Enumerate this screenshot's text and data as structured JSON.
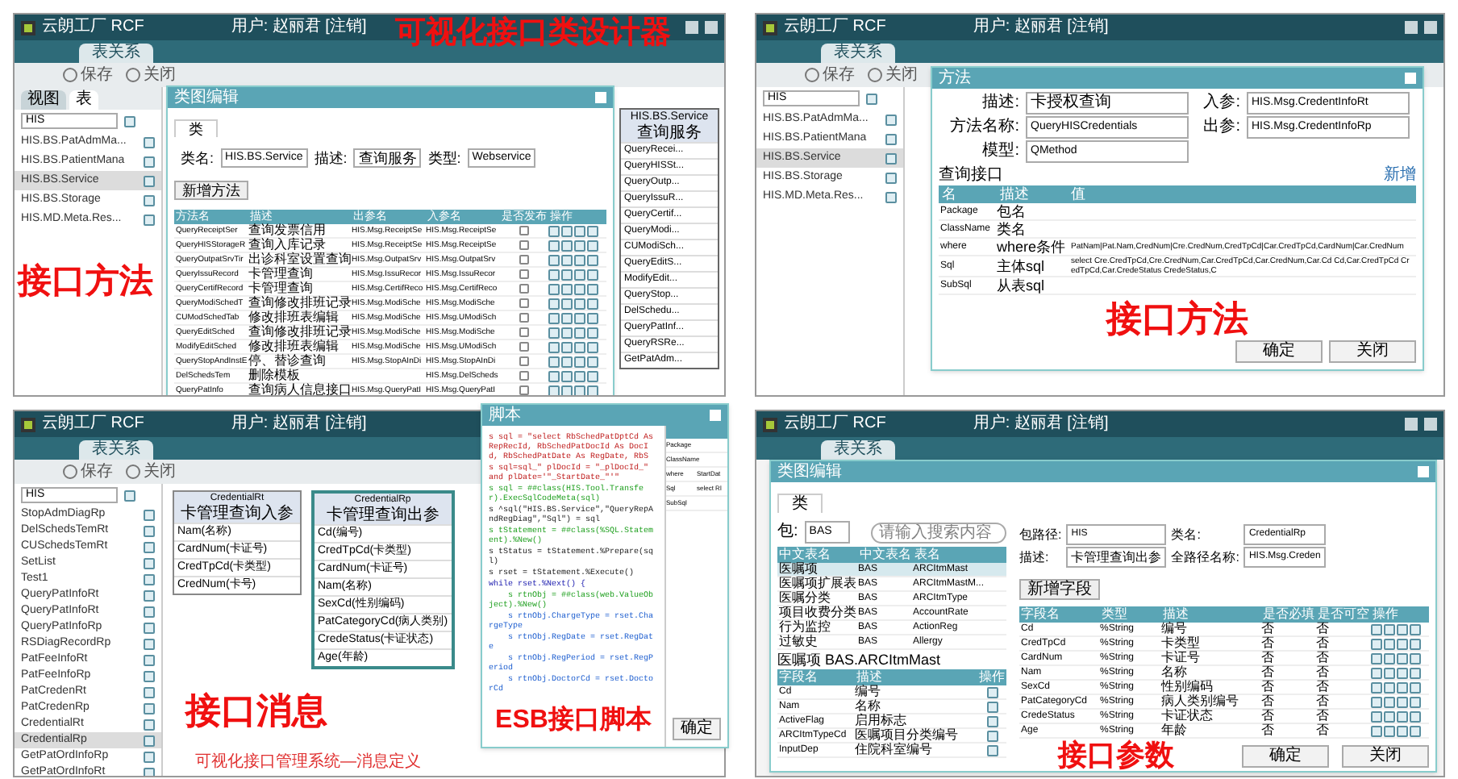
{
  "designer": {
    "app_title": "云朗工厂 RCF",
    "user": "用户: 赵丽君 [注销]",
    "tab": "表关系",
    "toolbar": [
      "保存",
      "关闭"
    ],
    "overlay": "可视化接口类设计器",
    "sidebar": {
      "tabs": [
        {
          "label": "视图",
          "selected": true
        },
        {
          "label": "表",
          "selected": false
        }
      ],
      "search": "HIS",
      "items": [
        {
          "label": "HIS.BS.PatAdmMa...",
          "selected": false
        },
        {
          "label": "HIS.BS.PatientMana",
          "selected": false
        },
        {
          "label": "HIS.BS.Service",
          "selected": true
        },
        {
          "label": "HIS.BS.Storage",
          "selected": false
        },
        {
          "label": "HIS.MD.Meta.Res...",
          "selected": false
        }
      ]
    },
    "dialog": {
      "title": "类图编辑",
      "tab": "类",
      "fields": [
        {
          "label": "类名:",
          "value": "HIS.BS.Service"
        },
        {
          "label": "描述:",
          "value": "查询服务"
        },
        {
          "label": "类型:",
          "value": "Webservice"
        }
      ],
      "add_button": "新增方法",
      "overlay": "接口方法",
      "columns": [
        "方法名",
        "描述",
        "出参名",
        "入参名",
        "是否发布",
        "操作"
      ],
      "rows": [
        {
          "name": "QueryReceiptSer",
          "desc": "查询发票信用",
          "out": "HIS.Msg.ReceiptSe",
          "in": "HIS.Msg.ReceiptSe",
          "published": false
        },
        {
          "name": "QueryHISStorageR",
          "desc": "查询入库记录",
          "out": "HIS.Msg.ReceiptSe",
          "in": "HIS.Msg.ReceiptSe",
          "published": false
        },
        {
          "name": "QueryOutpatSrvTir",
          "desc": "出诊科室设置查询",
          "out": "HIS.Msg.OutpatSrv",
          "in": "HIS.Msg.OutpatSrv",
          "published": false
        },
        {
          "name": "QueryIssuRecord",
          "desc": "卡管理查询",
          "out": "HIS.Msg.IssuRecor",
          "in": "HIS.Msg.IssuRecor",
          "published": false
        },
        {
          "name": "QueryCertifRecord",
          "desc": "卡管理查询",
          "out": "HIS.Msg.CertifReco",
          "in": "HIS.Msg.CertifReco",
          "published": false
        },
        {
          "name": "QueryModiSchedT",
          "desc": "查询修改排班记录",
          "out": "HIS.Msg.ModiSche",
          "in": "HIS.Msg.ModiSche",
          "published": false
        },
        {
          "name": "CUModSchedTab",
          "desc": "修改排班表编辑",
          "out": "HIS.Msg.ModiSche",
          "in": "HIS.Msg.UModiSch",
          "published": false
        },
        {
          "name": "QueryEditSched",
          "desc": "查询修改排班记录",
          "out": "HIS.Msg.ModiSche",
          "in": "HIS.Msg.ModiSche",
          "published": false
        },
        {
          "name": "ModifyEditSched",
          "desc": "修改排班表编辑",
          "out": "HIS.Msg.ModiSche",
          "in": "HIS.Msg.UModiSch",
          "published": false
        },
        {
          "name": "QueryStopAndInstE",
          "desc": "停、替诊查询",
          "out": "HIS.Msg.StopAInDi",
          "in": "HIS.Msg.StopAInDi",
          "published": false
        },
        {
          "name": "DelSchedsTem",
          "desc": "删除模板",
          "out": "",
          "in": "HIS.Msg.DelScheds",
          "published": false
        },
        {
          "name": "QueryPatInfo",
          "desc": "查询病人信息接口",
          "out": "HIS.Msg.QueryPatI",
          "in": "HIS.Msg.QueryPatI",
          "published": false
        }
      ]
    },
    "class_box": {
      "title": "HIS.BS.Service",
      "subtitle": "查询服务",
      "methods": [
        "QueryRecei...",
        "QueryHISSt...",
        "QueryOutp...",
        "QueryIssuR...",
        "QueryCertif...",
        "QueryModi...",
        "CUModiSch...",
        "QueryEditS...",
        "ModifyEdit...",
        "QueryStop...",
        "DelSchedu...",
        "QueryPatInf...",
        "QueryRSRe...",
        "GetPatAdm..."
      ]
    }
  },
  "method_editor": {
    "app_title": "云朗工厂 RCF",
    "user": "用户: 赵丽君 [注销]",
    "tab": "表关系",
    "toolbar": [
      "保存",
      "关闭"
    ],
    "sidebar": {
      "search": "HIS",
      "items": [
        {
          "label": "HIS.BS.PatAdmMa...",
          "selected": false
        },
        {
          "label": "HIS.BS.PatientMana",
          "selected": false
        },
        {
          "label": "HIS.BS.Service",
          "selected": true
        },
        {
          "label": "HIS.BS.Storage",
          "selected": false
        },
        {
          "label": "HIS.MD.Meta.Res...",
          "selected": false
        }
      ]
    },
    "dialog": {
      "title": "方法",
      "fields": [
        {
          "label": "描述:",
          "value": "卡授权查询"
        },
        {
          "label": "入参:",
          "value": "HIS.Msg.CredentInfoRt"
        },
        {
          "label": "方法名称:",
          "value": "QueryHISCredentials"
        },
        {
          "label": "出参:",
          "value": "HIS.Msg.CredentInfoRp"
        },
        {
          "label": "模型:",
          "value": "QMethod"
        }
      ],
      "section": "查询接口",
      "add_link": "新增",
      "overlay": "接口方法",
      "columns": [
        "名",
        "描述",
        "值"
      ],
      "rows": [
        {
          "name": "Package",
          "desc": "包名",
          "value": ""
        },
        {
          "name": "ClassName",
          "desc": "类名",
          "value": ""
        },
        {
          "name": "where",
          "desc": "where条件",
          "value": "PatNam|Pat.Nam,CredNum|Cre.CredNum,CredTpCd|Car.CredTpCd,CardNum|Car.CredNum"
        },
        {
          "name": "Sql",
          "desc": "主体sql",
          "value": "select Cre.CredTpCd,Cre.CredNum,Car.CredTpCd,Car.CredNum,Car.Cd Cd,Car.CredTpCd CredTpCd,Car.CredeStatus CredeStatus,C"
        },
        {
          "name": "SubSql",
          "desc": "从表sql",
          "value": ""
        }
      ],
      "buttons": [
        "确定",
        "关闭"
      ]
    }
  },
  "message_diagram": {
    "app_title": "云朗工厂 RCF",
    "user": "用户: 赵丽君 [注销]",
    "tab": "表关系",
    "toolbar": [
      "保存",
      "关闭"
    ],
    "overlay": "接口消息",
    "caption": "可视化接口管理系统—消息定义",
    "sidebar": {
      "search": "HIS",
      "items": [
        {
          "label": "StopAdmDiagRp",
          "selected": false
        },
        {
          "label": "DelSchedsTemRt",
          "selected": false
        },
        {
          "label": "CUSchedsTemRt",
          "selected": false
        },
        {
          "label": "SetList",
          "selected": false
        },
        {
          "label": "Test1",
          "selected": false
        },
        {
          "label": "QueryPatInfoRt",
          "selected": false
        },
        {
          "label": "QueryPatInfoRt",
          "selected": false
        },
        {
          "label": "QueryPatInfoRp",
          "selected": false
        },
        {
          "label": "RSDiagRecordRp",
          "selected": false
        },
        {
          "label": "PatFeeInfoRt",
          "selected": false
        },
        {
          "label": "PatFeeInfoRp",
          "selected": false
        },
        {
          "label": "PatCredenRt",
          "selected": false
        },
        {
          "label": "PatCredenRp",
          "selected": false
        },
        {
          "label": "CredentialRt",
          "selected": false
        },
        {
          "label": "CredentialRp",
          "selected": true
        },
        {
          "label": "GetPatOrdInfoRp",
          "selected": false
        },
        {
          "label": "GetPatOrdInfoRt",
          "selected": false
        }
      ]
    },
    "classes": [
      {
        "name": "CredentialRt",
        "subtitle": "卡管理查询入参",
        "selected": false,
        "fields": [
          "Nam(名称)",
          "CardNum(卡证号)",
          "CredTpCd(卡类型)",
          "CredNum(卡号)"
        ]
      },
      {
        "name": "CredentialRp",
        "subtitle": "卡管理查询出参",
        "selected": true,
        "fields": [
          "Cd(编号)",
          "CredTpCd(卡类型)",
          "CardNum(卡证号)",
          "Nam(名称)",
          "SexCd(性别编码)",
          "PatCategoryCd(病人类别)",
          "CredeStatus(卡证状态)",
          "Age(年龄)"
        ]
      }
    ]
  },
  "script_popup": {
    "title": "脚本",
    "overlay": "ESB接口脚本",
    "lines": [
      {
        "kind": "string",
        "text": "s sql = \"select RbSchedPatDptCd As RepRecId, RbSchedPatDocId As DocId, RbSchedPatDate As RegDate, RbS"
      },
      {
        "kind": "string",
        "text": "s sql=sql_\" plDocId = \"_plDocId_\" and plDate='\"_StartDate_\"'\""
      },
      {
        "kind": "call",
        "text": "s sql = ##class(HIS.Tool.Transfer).ExecSqlCodeMeta(sql)"
      },
      {
        "kind": "plain",
        "text": "s ^sql(\"HIS.BS.Service\",\"QueryRepAndRegDiag\",\"Sql\") = sql"
      },
      {
        "kind": "call",
        "text": "s tStatement = ##class(%SQL.Statement).%New()"
      },
      {
        "kind": "plain",
        "text": "s tStatus = tStatement.%Prepare(sql)"
      },
      {
        "kind": "plain",
        "text": "s rset = tStatement.%Execute()"
      },
      {
        "kind": "keyword",
        "text": "while rset.%Next() {"
      },
      {
        "kind": "call",
        "text": "    s rtnObj = ##class(web.ValueObject).%New()"
      },
      {
        "kind": "field",
        "text": "    s rtnObj.ChargeType = rset.ChargeType"
      },
      {
        "kind": "field",
        "text": "    s rtnObj.RegDate = rset.RegDate"
      },
      {
        "kind": "field",
        "text": "    s rtnObj.RegPeriod = rset.RegPeriod"
      },
      {
        "kind": "field",
        "text": "    s rtnObj.DoctorCd = rset.DoctorCd"
      }
    ],
    "side_rows": [
      {
        "name": "Package",
        "value": ""
      },
      {
        "name": "ClassName",
        "value": ""
      },
      {
        "name": "where",
        "value": "StartDat"
      },
      {
        "name": "Sql",
        "value": "select Rl"
      },
      {
        "name": "SubSql",
        "value": ""
      }
    ],
    "button": "确定"
  },
  "parameter_editor": {
    "app_title": "云朗工厂 RCF",
    "user": "用户: 赵丽君 [注销]",
    "tab": "表关系",
    "dialog": {
      "title": "类图编辑",
      "tab": "类",
      "package_label": "包:",
      "package": "BAS",
      "search": {
        "placeholder": "请输入搜索内容"
      },
      "table_columns": [
        "中文表名",
        "中文表名",
        "表名"
      ],
      "tables": [
        {
          "cn": "医嘱项",
          "pkg": "BAS",
          "name": "ARCItmMast",
          "selected": true
        },
        {
          "cn": "医嘱项扩展表",
          "pkg": "BAS",
          "name": "ARCItmMastM...",
          "selected": false
        },
        {
          "cn": "医嘱分类",
          "pkg": "BAS",
          "name": "ARCItmType",
          "selected": false
        },
        {
          "cn": "项目收费分类",
          "pkg": "BAS",
          "name": "AccountRate",
          "selected": false
        },
        {
          "cn": "行为监控",
          "pkg": "BAS",
          "name": "ActionReg",
          "selected": false
        },
        {
          "cn": "过敏史",
          "pkg": "BAS",
          "name": "Allergy",
          "selected": false
        }
      ],
      "table_caption": "医嘱项 BAS.ARCItmMast",
      "field_columns": [
        "字段名",
        "描述",
        "操作"
      ],
      "source_fields": [
        {
          "name": "Cd",
          "desc": "编号"
        },
        {
          "name": "Nam",
          "desc": "名称"
        },
        {
          "name": "ActiveFlag",
          "desc": "启用标志"
        },
        {
          "name": "ARCItmTypeCd",
          "desc": "医嘱项目分类编号"
        },
        {
          "name": "InputDep",
          "desc": "住院科室编号"
        }
      ],
      "fields": [
        {
          "label": "包路径:",
          "value": "HIS"
        },
        {
          "label": "类名:",
          "value": "CredentialRp"
        },
        {
          "label": "描述:",
          "value": "卡管理查询出参"
        },
        {
          "label": "全路径名称:",
          "value": "HIS.Msg.Creden"
        }
      ],
      "add_button": "新增字段",
      "overlay": "接口参数",
      "columns": [
        "字段名",
        "类型",
        "描述",
        "是否必填",
        "是否可空",
        "操作"
      ],
      "rows": [
        {
          "name": "Cd",
          "type": "%String",
          "desc": "编号",
          "required": "否",
          "nullable": "否"
        },
        {
          "name": "CredTpCd",
          "type": "%String",
          "desc": "卡类型",
          "required": "否",
          "nullable": "否"
        },
        {
          "name": "CardNum",
          "type": "%String",
          "desc": "卡证号",
          "required": "否",
          "nullable": "否"
        },
        {
          "name": "Nam",
          "type": "%String",
          "desc": "名称",
          "required": "否",
          "nullable": "否"
        },
        {
          "name": "SexCd",
          "type": "%String",
          "desc": "性别编码",
          "required": "否",
          "nullable": "否"
        },
        {
          "name": "PatCategoryCd",
          "type": "%String",
          "desc": "病人类别编号",
          "required": "否",
          "nullable": "否"
        },
        {
          "name": "CredeStatus",
          "type": "%String",
          "desc": "卡证状态",
          "required": "否",
          "nullable": "否"
        },
        {
          "name": "Age",
          "type": "%String",
          "desc": "年龄",
          "required": "否",
          "nullable": "否"
        }
      ],
      "buttons": [
        "确定",
        "关闭"
      ]
    }
  }
}
